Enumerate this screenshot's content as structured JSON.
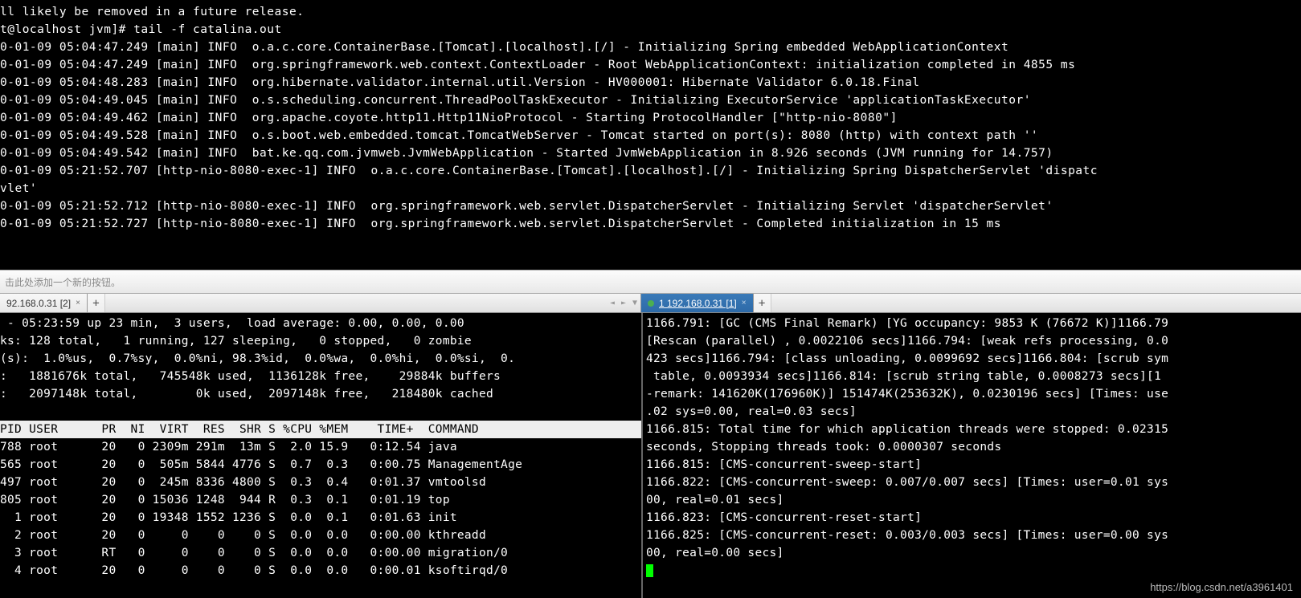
{
  "top_terminal": {
    "lines": [
      "ll likely be removed in a future release.",
      "t@localhost jvm]# tail -f catalina.out",
      "0-01-09 05:04:47.249 [main] INFO  o.a.c.core.ContainerBase.[Tomcat].[localhost].[/] - Initializing Spring embedded WebApplicationContext",
      "0-01-09 05:04:47.249 [main] INFO  org.springframework.web.context.ContextLoader - Root WebApplicationContext: initialization completed in 4855 ms",
      "0-01-09 05:04:48.283 [main] INFO  org.hibernate.validator.internal.util.Version - HV000001: Hibernate Validator 6.0.18.Final",
      "0-01-09 05:04:49.045 [main] INFO  o.s.scheduling.concurrent.ThreadPoolTaskExecutor - Initializing ExecutorService 'applicationTaskExecutor'",
      "0-01-09 05:04:49.462 [main] INFO  org.apache.coyote.http11.Http11NioProtocol - Starting ProtocolHandler [\"http-nio-8080\"]",
      "0-01-09 05:04:49.528 [main] INFO  o.s.boot.web.embedded.tomcat.TomcatWebServer - Tomcat started on port(s): 8080 (http) with context path ''",
      "0-01-09 05:04:49.542 [main] INFO  bat.ke.qq.com.jvmweb.JvmWebApplication - Started JvmWebApplication in 8.926 seconds (JVM running for 14.757)",
      "0-01-09 05:21:52.707 [http-nio-8080-exec-1] INFO  o.a.c.core.ContainerBase.[Tomcat].[localhost].[/] - Initializing Spring DispatcherServlet 'dispatc",
      "vlet'",
      "0-01-09 05:21:52.712 [http-nio-8080-exec-1] INFO  org.springframework.web.servlet.DispatcherServlet - Initializing Servlet 'dispatcherServlet'",
      "0-01-09 05:21:52.727 [http-nio-8080-exec-1] INFO  org.springframework.web.servlet.DispatcherServlet - Completed initialization in 15 ms",
      ""
    ]
  },
  "toolbar": {
    "hint": "击此处添加一个新的按钮。"
  },
  "tabs": {
    "left": {
      "label": "92.168.0.31 [2]"
    },
    "right": {
      "label": "1 192.168.0.31 [1]"
    },
    "add": "+"
  },
  "left_pane": {
    "summary_lines": [
      " - 05:23:59 up 23 min,  3 users,  load average: 0.00, 0.00, 0.00",
      "ks: 128 total,   1 running, 127 sleeping,   0 stopped,   0 zombie",
      "(s):  1.0%us,  0.7%sy,  0.0%ni, 98.3%id,  0.0%wa,  0.0%hi,  0.0%si,  0.",
      ":   1881676k total,   745548k used,  1136128k free,    29884k buffers",
      ":   2097148k total,        0k used,  2097148k free,   218480k cached",
      ""
    ],
    "header": "PID USER      PR  NI  VIRT  RES  SHR S %CPU %MEM    TIME+  COMMAND     ",
    "rows": [
      "788 root      20   0 2309m 291m  13m S  2.0 15.9   0:12.54 java",
      "565 root      20   0  505m 5844 4776 S  0.7  0.3   0:00.75 ManagementAge",
      "497 root      20   0  245m 8336 4800 S  0.3  0.4   0:01.37 vmtoolsd",
      "805 root      20   0 15036 1248  944 R  0.3  0.1   0:01.19 top",
      "  1 root      20   0 19348 1552 1236 S  0.0  0.1   0:01.63 init",
      "  2 root      20   0     0    0    0 S  0.0  0.0   0:00.00 kthreadd",
      "  3 root      RT   0     0    0    0 S  0.0  0.0   0:00.00 migration/0",
      "  4 root      20   0     0    0    0 S  0.0  0.0   0:00.01 ksoftirqd/0"
    ]
  },
  "right_pane": {
    "lines": [
      "1166.791: [GC (CMS Final Remark) [YG occupancy: 9853 K (76672 K)]1166.79",
      "[Rescan (parallel) , 0.0022106 secs]1166.794: [weak refs processing, 0.0",
      "423 secs]1166.794: [class unloading, 0.0099692 secs]1166.804: [scrub sym",
      " table, 0.0093934 secs]1166.814: [scrub string table, 0.0008273 secs][1 ",
      "-remark: 141620K(176960K)] 151474K(253632K), 0.0230196 secs] [Times: use",
      ".02 sys=0.00, real=0.03 secs]",
      "1166.815: Total time for which application threads were stopped: 0.02315",
      "seconds, Stopping threads took: 0.0000307 seconds",
      "1166.815: [CMS-concurrent-sweep-start]",
      "1166.822: [CMS-concurrent-sweep: 0.007/0.007 secs] [Times: user=0.01 sys",
      "00, real=0.01 secs]",
      "1166.823: [CMS-concurrent-reset-start]",
      "1166.825: [CMS-concurrent-reset: 0.003/0.003 secs] [Times: user=0.00 sys",
      "00, real=0.00 secs]"
    ]
  },
  "watermark": "https://blog.csdn.net/a3961401"
}
